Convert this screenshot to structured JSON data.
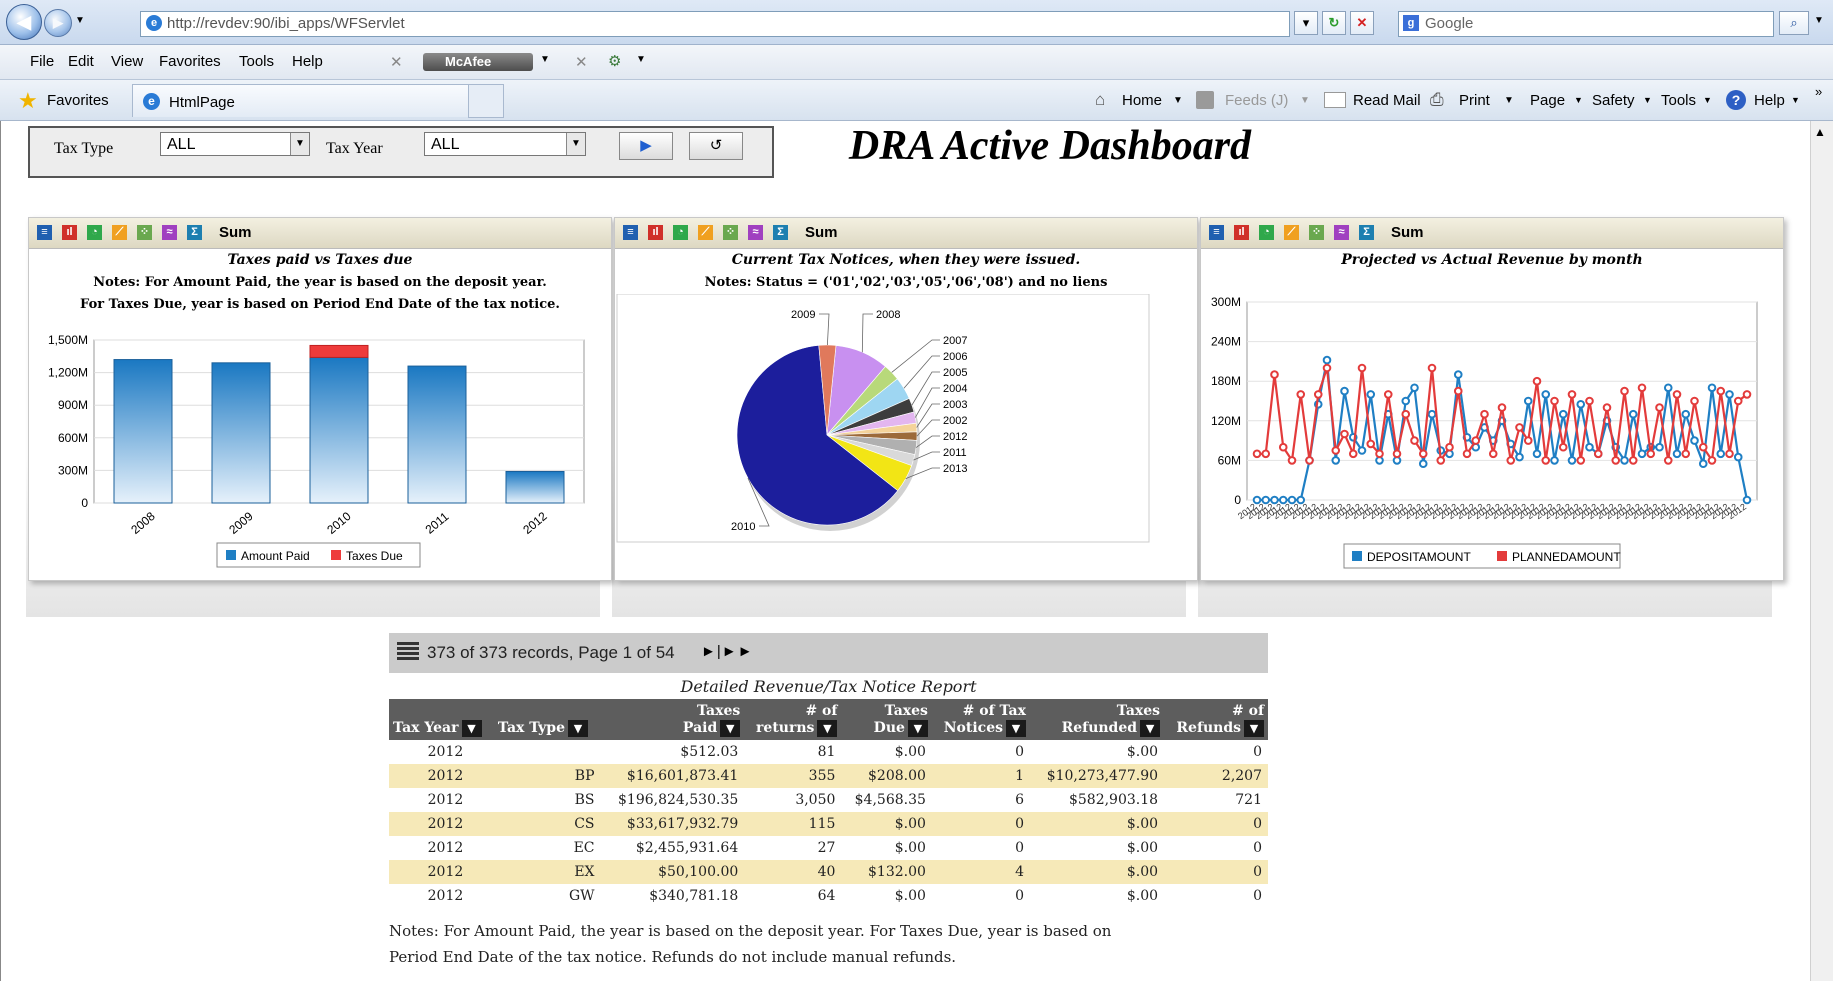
{
  "browser": {
    "address": "http://revdev:90/ibi_apps/WFServlet",
    "search_placeholder": "Google",
    "menu": [
      "File",
      "Edit",
      "View",
      "Favorites",
      "Tools",
      "Help"
    ],
    "mcafee": "McAfee",
    "favorites_label": "Favorites",
    "tab_title": "HtmlPage",
    "commands": [
      "Home",
      "Feeds (J)",
      "Read Mail",
      "Print",
      "Page",
      "Safety",
      "Tools",
      "Help"
    ]
  },
  "filters": {
    "tax_type_label": "Tax Type",
    "tax_type_value": "ALL",
    "tax_year_label": "Tax Year",
    "tax_year_value": "ALL",
    "run_button": "▶",
    "reset_button": "↺"
  },
  "dashboard_title": "DRA Active Dashboard",
  "panels": {
    "sum_label": "Sum",
    "bar": {
      "title": "Taxes paid vs Taxes due",
      "note1": "Notes: For Amount Paid, the year is based on the deposit year.",
      "note2": "For Taxes Due, year is based on Period End Date of the tax notice."
    },
    "pie": {
      "title": "Current Tax Notices, when they were issued.",
      "note1": "Notes: Status = ('01','02','03','05','06','08') and no liens"
    },
    "line": {
      "title": "Projected vs Actual Revenue by month"
    }
  },
  "chart_data": [
    {
      "type": "bar",
      "title": "Taxes paid vs Taxes due",
      "categories": [
        "2008",
        "2009",
        "2010",
        "2011",
        "2012"
      ],
      "series": [
        {
          "name": "Amount Paid",
          "values": [
            1320000000,
            1290000000,
            1340000000,
            1260000000,
            290000000
          ],
          "color": "#1f7fc4"
        },
        {
          "name": "Taxes Due",
          "values": [
            0,
            0,
            110000000,
            0,
            0
          ],
          "color": "#ee3b3b"
        }
      ],
      "stacked": true,
      "ylim": [
        0,
        1500000000
      ],
      "yticks": [
        "0",
        "300M",
        "600M",
        "900M",
        "1,200M",
        "1,500M"
      ]
    },
    {
      "type": "pie",
      "title": "Current Tax Notices, when they were issued.",
      "slices": [
        {
          "label": "2010",
          "value": 62.0,
          "color": "#1c1e9c"
        },
        {
          "label": "2011",
          "value": 2.0,
          "color": "#d9d9d9"
        },
        {
          "label": "2012",
          "value": 2.5,
          "color": "#b0b0b0"
        },
        {
          "label": "2013",
          "value": 5.0,
          "color": "#f2e515"
        },
        {
          "label": "2002",
          "value": 1.5,
          "color": "#9c6a3a"
        },
        {
          "label": "2003",
          "value": 1.5,
          "color": "#f4d39a"
        },
        {
          "label": "2004",
          "value": 2.0,
          "color": "#e3b6f0"
        },
        {
          "label": "2005",
          "value": 2.5,
          "color": "#3d3d3d"
        },
        {
          "label": "2006",
          "value": 4.0,
          "color": "#9ed6f2"
        },
        {
          "label": "2007",
          "value": 3.0,
          "color": "#b8d97a"
        },
        {
          "label": "2008",
          "value": 9.5,
          "color": "#c890f0"
        },
        {
          "label": "2009",
          "value": 3.0,
          "color": "#e0795c"
        }
      ]
    },
    {
      "type": "line",
      "title": "Projected vs Actual Revenue by month",
      "ylim": [
        0,
        300000000
      ],
      "yticks": [
        "0",
        "60M",
        "120M",
        "180M",
        "240M",
        "300M"
      ],
      "series": [
        {
          "name": "DEPOSITAMOUNT",
          "color": "#1f7fc4",
          "values": [
            0,
            0,
            0,
            0,
            0,
            0,
            60,
            145,
            212,
            60,
            165,
            95,
            75,
            160,
            60,
            130,
            60,
            150,
            170,
            55,
            130,
            75,
            70,
            190,
            95,
            80,
            110,
            90,
            120,
            85,
            65,
            150,
            70,
            160,
            60,
            130,
            60,
            145,
            80,
            70,
            120,
            80,
            60,
            130,
            70,
            80,
            80,
            170,
            70,
            130,
            90,
            55,
            170,
            70,
            160,
            65,
            0
          ]
        },
        {
          "name": "PLANNEDAMOUNT",
          "color": "#e33b3b",
          "values": [
            70,
            70,
            190,
            80,
            60,
            160,
            60,
            160,
            200,
            75,
            100,
            70,
            200,
            85,
            70,
            160,
            70,
            130,
            90,
            70,
            200,
            60,
            80,
            165,
            70,
            90,
            130,
            70,
            140,
            60,
            110,
            90,
            180,
            60,
            150,
            80,
            160,
            60,
            150,
            70,
            140,
            60,
            165,
            60,
            170,
            70,
            140,
            60,
            160,
            70,
            150,
            80,
            60,
            165,
            70,
            150,
            160
          ]
        }
      ]
    }
  ],
  "report": {
    "pager_text": "373 of 373 records, Page 1 of 54",
    "title": "Detailed Revenue/Tax Notice Report",
    "columns": [
      {
        "top": "",
        "bottom": "Tax Year"
      },
      {
        "top": "",
        "bottom": "Tax Type"
      },
      {
        "top": "Taxes",
        "bottom": "Paid"
      },
      {
        "top": "# of",
        "bottom": "returns"
      },
      {
        "top": "Taxes",
        "bottom": "Due"
      },
      {
        "top": "# of Tax",
        "bottom": "Notices"
      },
      {
        "top": "Taxes",
        "bottom": "Refunded"
      },
      {
        "top": "# of",
        "bottom": "Refunds"
      }
    ],
    "rows": [
      [
        "2012",
        "",
        "$512.03",
        "81",
        "$.00",
        "0",
        "$.00",
        "0"
      ],
      [
        "2012",
        "BP",
        "$16,601,873.41",
        "355",
        "$208.00",
        "1",
        "$10,273,477.90",
        "2,207"
      ],
      [
        "2012",
        "BS",
        "$196,824,530.35",
        "3,050",
        "$4,568.35",
        "6",
        "$582,903.18",
        "721"
      ],
      [
        "2012",
        "CS",
        "$33,617,932.79",
        "115",
        "$.00",
        "0",
        "$.00",
        "0"
      ],
      [
        "2012",
        "EC",
        "$2,455,931.64",
        "27",
        "$.00",
        "0",
        "$.00",
        "0"
      ],
      [
        "2012",
        "EX",
        "$50,100.00",
        "40",
        "$132.00",
        "4",
        "$.00",
        "0"
      ],
      [
        "2012",
        "GW",
        "$340,781.18",
        "64",
        "$.00",
        "0",
        "$.00",
        "0"
      ]
    ],
    "notes1": "Notes: For Amount Paid, the year is based on the deposit year. For Taxes Due, year is based on",
    "notes2": "Period End Date of the tax notice. Refunds do not include manual refunds."
  }
}
